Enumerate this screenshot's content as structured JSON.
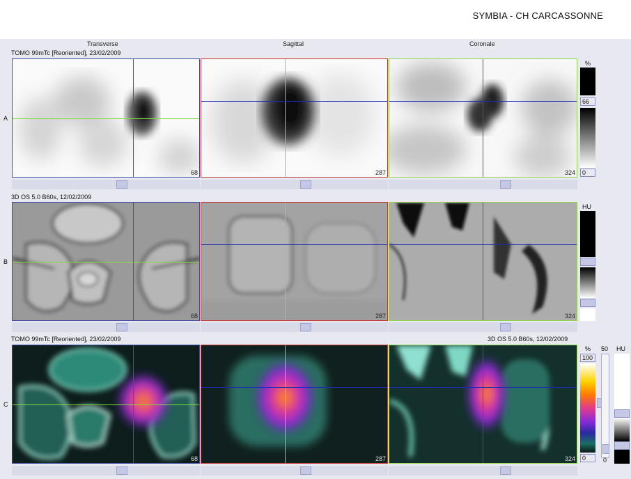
{
  "site": "SYMBIA - CH CARCASSONNE",
  "headers": {
    "transverse": "Transverse",
    "sagittal": "Sagittal",
    "coronal": "Coronale"
  },
  "rows": {
    "a": {
      "letter": "A",
      "series": "TOMO 99mTc [Reoriented], 23/02/2009"
    },
    "b": {
      "letter": "B",
      "series": "3D  OS  5.0  B60s, 12/02/2009"
    },
    "c": {
      "letter": "C",
      "series_left": "TOMO 99mTc [Reoriented], 23/02/2009",
      "series_right": "3D  OS  5.0  B60s, 12/02/2009"
    }
  },
  "slices": {
    "transverse": "68",
    "sagittal": "287",
    "coronal": "324"
  },
  "scales": {
    "a": {
      "unit": "%",
      "level": "66",
      "min": "0"
    },
    "b": {
      "unit": "HU"
    },
    "c": {
      "unit": "%",
      "max": "100",
      "min": "0",
      "mid": "50",
      "unit2": "HU",
      "zero": "0"
    }
  },
  "colors": {
    "crosshair_red": "#d42020",
    "crosshair_green": "#7ee03c",
    "crosshair_blue": "#1e2bb0"
  }
}
